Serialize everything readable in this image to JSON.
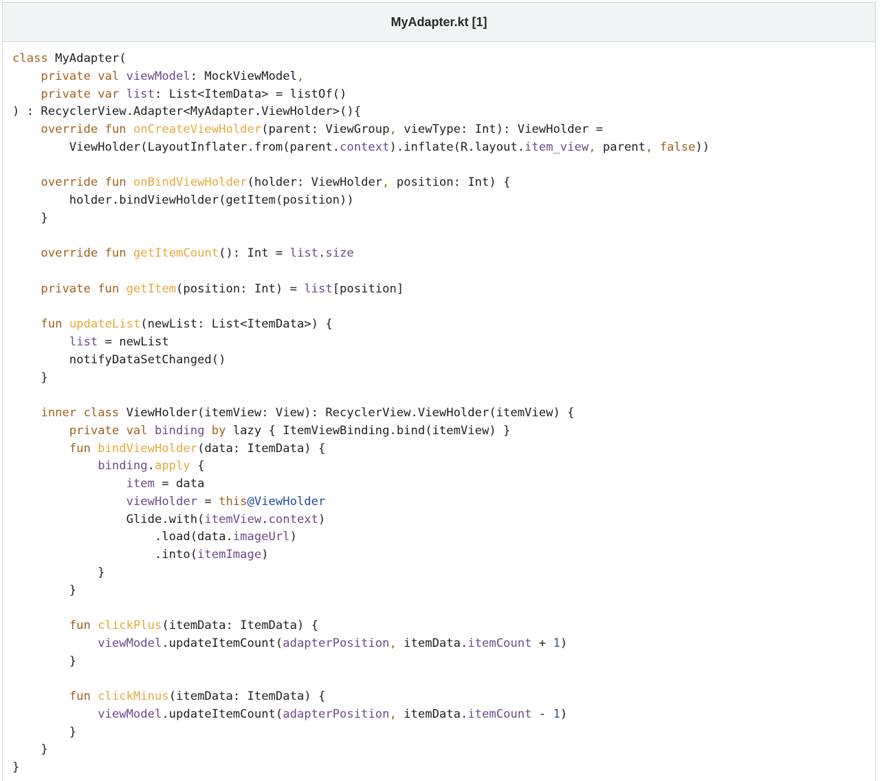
{
  "file": {
    "title": "MyAdapter.kt [1]"
  },
  "colors": {
    "keyword": "#a0611a",
    "function": "#e6a83a",
    "property": "#6b4a8a",
    "number": "#2a5a8c",
    "label": "#1e4fa0",
    "text": "#1f1f1f"
  },
  "code": [
    [
      [
        "kw",
        "class"
      ],
      [
        "p",
        " MyAdapter("
      ]
    ],
    [
      [
        "p",
        "    "
      ],
      [
        "kw",
        "private val"
      ],
      [
        "p",
        " "
      ],
      [
        "prop",
        "viewModel"
      ],
      [
        "p",
        ": MockViewModel"
      ],
      [
        "kw",
        ","
      ]
    ],
    [
      [
        "p",
        "    "
      ],
      [
        "kw",
        "private var"
      ],
      [
        "p",
        " "
      ],
      [
        "prop",
        "list"
      ],
      [
        "p",
        ": List<ItemData> = listOf()"
      ]
    ],
    [
      [
        "p",
        ") : RecyclerView.Adapter<MyAdapter.ViewHolder>(){"
      ]
    ],
    [
      [
        "p",
        "    "
      ],
      [
        "kw",
        "override fun"
      ],
      [
        "p",
        " "
      ],
      [
        "fn",
        "onCreateViewHolder"
      ],
      [
        "p",
        "(parent: ViewGroup"
      ],
      [
        "kw",
        ","
      ],
      [
        "p",
        " viewType: Int): ViewHolder ="
      ]
    ],
    [
      [
        "p",
        "        ViewHolder(LayoutInflater.from(parent."
      ],
      [
        "prop",
        "context"
      ],
      [
        "p",
        ").inflate(R.layout."
      ],
      [
        "prop",
        "item_view"
      ],
      [
        "kw",
        ","
      ],
      [
        "p",
        " parent"
      ],
      [
        "kw",
        ","
      ],
      [
        "p",
        " "
      ],
      [
        "kw",
        "false"
      ],
      [
        "p",
        "))"
      ]
    ],
    [
      [
        "p",
        ""
      ]
    ],
    [
      [
        "p",
        "    "
      ],
      [
        "kw",
        "override fun"
      ],
      [
        "p",
        " "
      ],
      [
        "fn",
        "onBindViewHolder"
      ],
      [
        "p",
        "(holder: ViewHolder"
      ],
      [
        "kw",
        ","
      ],
      [
        "p",
        " position: Int) {"
      ]
    ],
    [
      [
        "p",
        "        holder.bindViewHolder(getItem(position))"
      ]
    ],
    [
      [
        "p",
        "    }"
      ]
    ],
    [
      [
        "p",
        ""
      ]
    ],
    [
      [
        "p",
        "    "
      ],
      [
        "kw",
        "override fun"
      ],
      [
        "p",
        " "
      ],
      [
        "fn",
        "getItemCount"
      ],
      [
        "p",
        "(): Int = "
      ],
      [
        "prop",
        "list"
      ],
      [
        "p",
        "."
      ],
      [
        "prop",
        "size"
      ]
    ],
    [
      [
        "p",
        ""
      ]
    ],
    [
      [
        "p",
        "    "
      ],
      [
        "kw",
        "private fun"
      ],
      [
        "p",
        " "
      ],
      [
        "fn",
        "getItem"
      ],
      [
        "p",
        "(position: Int) = "
      ],
      [
        "prop",
        "list"
      ],
      [
        "p",
        "[position]"
      ]
    ],
    [
      [
        "p",
        ""
      ]
    ],
    [
      [
        "p",
        "    "
      ],
      [
        "kw",
        "fun"
      ],
      [
        "p",
        " "
      ],
      [
        "fn",
        "updateList"
      ],
      [
        "p",
        "(newList: List<ItemData>) {"
      ]
    ],
    [
      [
        "p",
        "        "
      ],
      [
        "prop",
        "list"
      ],
      [
        "p",
        " = newList"
      ]
    ],
    [
      [
        "p",
        "        notifyDataSetChanged()"
      ]
    ],
    [
      [
        "p",
        "    }"
      ]
    ],
    [
      [
        "p",
        ""
      ]
    ],
    [
      [
        "p",
        "    "
      ],
      [
        "kw",
        "inner class"
      ],
      [
        "p",
        " ViewHolder(itemView: View): RecyclerView.ViewHolder(itemView) {"
      ]
    ],
    [
      [
        "p",
        "        "
      ],
      [
        "kw",
        "private val"
      ],
      [
        "p",
        " "
      ],
      [
        "prop",
        "binding"
      ],
      [
        "p",
        " "
      ],
      [
        "kw",
        "by"
      ],
      [
        "p",
        " lazy { ItemViewBinding.bind(itemView) }"
      ]
    ],
    [
      [
        "p",
        "        "
      ],
      [
        "kw",
        "fun"
      ],
      [
        "p",
        " "
      ],
      [
        "fn",
        "bindViewHolder"
      ],
      [
        "p",
        "(data: ItemData) {"
      ]
    ],
    [
      [
        "p",
        "            "
      ],
      [
        "prop",
        "binding"
      ],
      [
        "p",
        "."
      ],
      [
        "fn",
        "apply"
      ],
      [
        "p",
        " {"
      ]
    ],
    [
      [
        "p",
        "                "
      ],
      [
        "prop",
        "item"
      ],
      [
        "p",
        " = data"
      ]
    ],
    [
      [
        "p",
        "                "
      ],
      [
        "prop",
        "viewHolder"
      ],
      [
        "p",
        " = "
      ],
      [
        "kw",
        "this"
      ],
      [
        "label",
        "@ViewHolder"
      ]
    ],
    [
      [
        "p",
        "                Glide.with("
      ],
      [
        "prop",
        "itemView"
      ],
      [
        "p",
        "."
      ],
      [
        "prop",
        "context"
      ],
      [
        "p",
        ")"
      ]
    ],
    [
      [
        "p",
        "                    .load(data."
      ],
      [
        "prop",
        "imageUrl"
      ],
      [
        "p",
        ")"
      ]
    ],
    [
      [
        "p",
        "                    .into("
      ],
      [
        "prop",
        "itemImage"
      ],
      [
        "p",
        ")"
      ]
    ],
    [
      [
        "p",
        "            }"
      ]
    ],
    [
      [
        "p",
        "        }"
      ]
    ],
    [
      [
        "p",
        ""
      ]
    ],
    [
      [
        "p",
        "        "
      ],
      [
        "kw",
        "fun"
      ],
      [
        "p",
        " "
      ],
      [
        "fn",
        "clickPlus"
      ],
      [
        "p",
        "(itemData: ItemData) {"
      ]
    ],
    [
      [
        "p",
        "            "
      ],
      [
        "prop",
        "viewModel"
      ],
      [
        "p",
        ".updateItemCount("
      ],
      [
        "prop",
        "adapterPosition"
      ],
      [
        "kw",
        ","
      ],
      [
        "p",
        " itemData."
      ],
      [
        "prop",
        "itemCount"
      ],
      [
        "p",
        " + "
      ],
      [
        "num",
        "1"
      ],
      [
        "p",
        ")"
      ]
    ],
    [
      [
        "p",
        "        }"
      ]
    ],
    [
      [
        "p",
        ""
      ]
    ],
    [
      [
        "p",
        "        "
      ],
      [
        "kw",
        "fun"
      ],
      [
        "p",
        " "
      ],
      [
        "fn",
        "clickMinus"
      ],
      [
        "p",
        "(itemData: ItemData) {"
      ]
    ],
    [
      [
        "p",
        "            "
      ],
      [
        "prop",
        "viewModel"
      ],
      [
        "p",
        ".updateItemCount("
      ],
      [
        "prop",
        "adapterPosition"
      ],
      [
        "kw",
        ","
      ],
      [
        "p",
        " itemData."
      ],
      [
        "prop",
        "itemCount"
      ],
      [
        "p",
        " - "
      ],
      [
        "num",
        "1"
      ],
      [
        "p",
        ")"
      ]
    ],
    [
      [
        "p",
        "        }"
      ]
    ],
    [
      [
        "p",
        "    }"
      ]
    ],
    [
      [
        "p",
        "}"
      ]
    ]
  ]
}
